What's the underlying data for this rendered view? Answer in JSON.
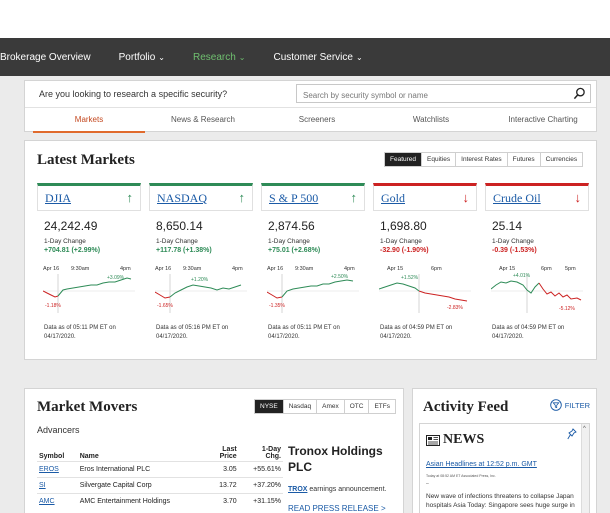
{
  "nav": {
    "items": [
      {
        "label": "Brokerage Overview",
        "has_dropdown": false,
        "active": false
      },
      {
        "label": "Portfolio",
        "has_dropdown": true,
        "active": false
      },
      {
        "label": "Research",
        "has_dropdown": true,
        "active": true
      },
      {
        "label": "Customer Service",
        "has_dropdown": true,
        "active": false
      }
    ]
  },
  "research": {
    "question": "Are you looking to research a specific security?",
    "search_placeholder": "Search by security symbol or name",
    "search_value": "",
    "tabs": [
      {
        "label": "Markets",
        "active": true
      },
      {
        "label": "News & Research",
        "active": false
      },
      {
        "label": "Screeners",
        "active": false
      },
      {
        "label": "Watchlists",
        "active": false
      },
      {
        "label": "Interactive Charting",
        "active": false
      }
    ]
  },
  "latest_markets": {
    "title": "Latest Markets",
    "filters": [
      {
        "label": "Featured",
        "active": true
      },
      {
        "label": "Equities",
        "active": false
      },
      {
        "label": "Interest Rates",
        "active": false
      },
      {
        "label": "Futures",
        "active": false
      },
      {
        "label": "Currencies",
        "active": false
      }
    ],
    "change_label": "1-Day Change",
    "cards": [
      {
        "name": "DJIA",
        "direction": "up",
        "value": "24,242.49",
        "change": "+704.81 (+2.99%)",
        "ticks": [
          "Apr 16",
          "9:30am",
          "4pm"
        ],
        "high_label": "+3.09%",
        "low_label": "-1.18%",
        "as_of": "Data as of 05:11 PM ET on 04/17/2020."
      },
      {
        "name": "NASDAQ",
        "direction": "up",
        "value": "8,650.14",
        "change": "+117.78 (+1.38%)",
        "ticks": [
          "Apr 16",
          "9:30am",
          "4pm"
        ],
        "high_label": "+1.20%",
        "low_label": "-1.65%",
        "as_of": "Data as of 05:16 PM ET on 04/17/2020."
      },
      {
        "name": "S & P 500",
        "direction": "up",
        "value": "2,874.56",
        "change": "+75.01 (+2.68%)",
        "ticks": [
          "Apr 16",
          "9:30am",
          "4pm"
        ],
        "high_label": "+2.50%",
        "low_label": "-1.35%",
        "as_of": "Data as of 05:11 PM ET on 04/17/2020."
      },
      {
        "name": "Gold",
        "direction": "down",
        "value": "1,698.80",
        "change": "-32.90 (-1.90%)",
        "ticks": [
          "Apr 15",
          "6pm"
        ],
        "high_label": "+1.52%",
        "low_label": "-2.83%",
        "as_of": "Data as of 04:59 PM ET on 04/17/2020."
      },
      {
        "name": "Crude Oil",
        "direction": "down",
        "value": "25.14",
        "change": "-0.39 (-1.53%)",
        "ticks": [
          "Apr 15",
          "6pm",
          "5pm"
        ],
        "high_label": "+4.01%",
        "low_label": "-5.12%",
        "as_of": "Data as of 04:59 PM ET on 04/17/2020."
      }
    ],
    "colors": {
      "up": "#2e8b57",
      "down": "#cc2222"
    }
  },
  "movers": {
    "title": "Market Movers",
    "exchanges": [
      {
        "label": "NYSE",
        "active": true
      },
      {
        "label": "Nasdaq",
        "active": false
      },
      {
        "label": "Amex",
        "active": false
      },
      {
        "label": "OTC",
        "active": false
      },
      {
        "label": "ETFs",
        "active": false
      }
    ],
    "subtitle": "Advancers",
    "headers": {
      "symbol": "Symbol",
      "name": "Name",
      "price_line1": "Last",
      "price_line2": "Price",
      "change_line1": "1-Day",
      "change_line2": "Chg."
    },
    "rows": [
      {
        "symbol": "EROS",
        "name": "Eros International PLC",
        "price": "3.05",
        "change": "+55.61%"
      },
      {
        "symbol": "SI",
        "name": "Silvergate Capital Corp",
        "price": "13.72",
        "change": "+37.20%"
      },
      {
        "symbol": "AMC",
        "name": "AMC Entertainment Holdings",
        "price": "3.70",
        "change": "+31.15%"
      }
    ],
    "featured": {
      "company": "Tronox Holdings PLC",
      "symbol": "TROX",
      "text": "earnings announcement.",
      "link": "READ PRESS RELEASE",
      "link_arrow": ">"
    }
  },
  "activity": {
    "title": "Activity Feed",
    "filter_label": "FILTER",
    "news_label": "NEWS",
    "scroll_arrow": "^",
    "headline": "Asian Headlines at 12:52 p.m. GMT",
    "meta": "Today at 08:52 AM ET  Associated Press, Inc.",
    "dash": "–",
    "summary": "New wave of infections threatens to collapse Japan hospitals Asia Today: Singapore sees huge surge in"
  }
}
